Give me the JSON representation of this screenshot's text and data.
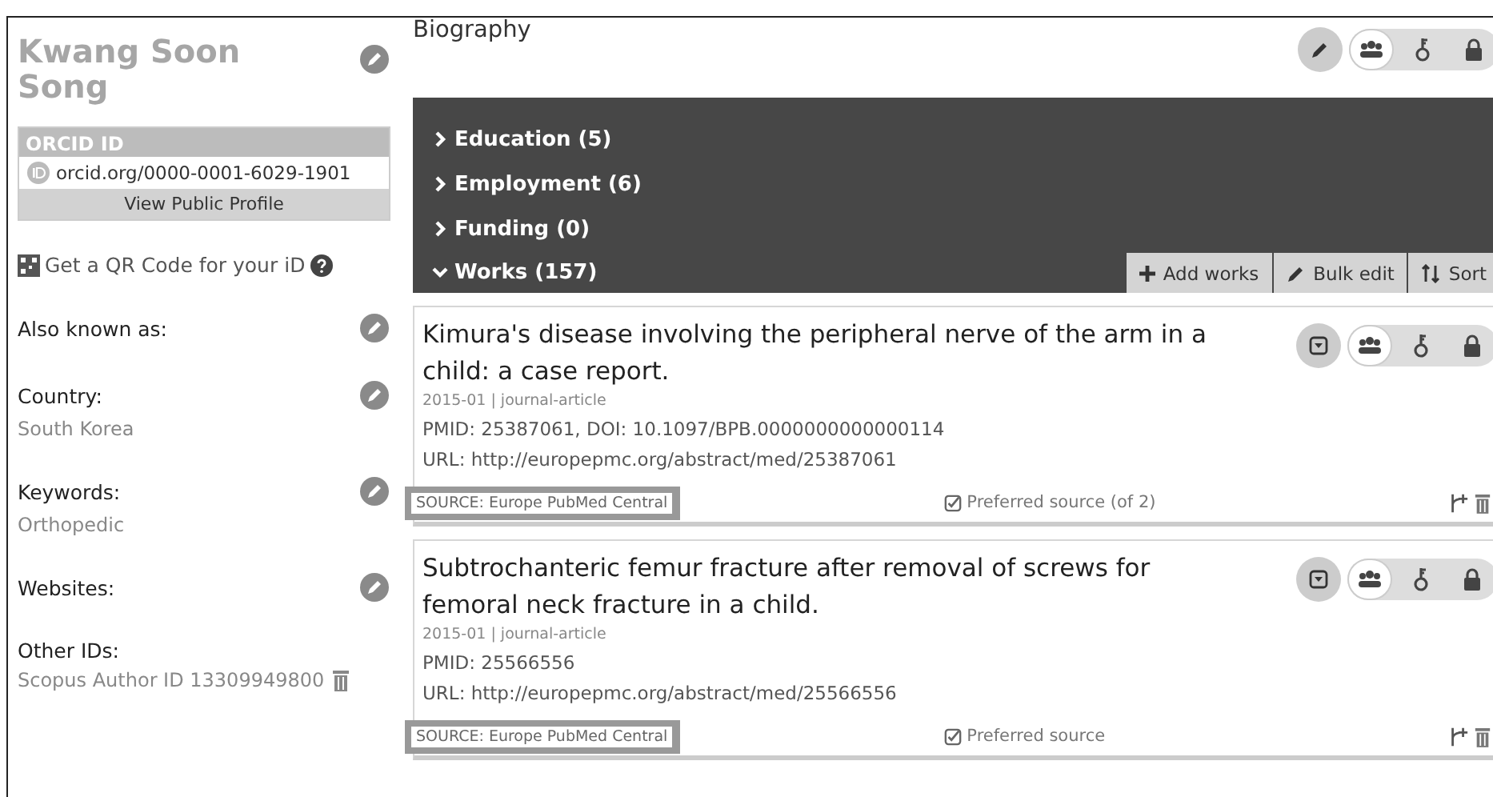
{
  "sidebar": {
    "name": "Kwang Soon Song",
    "orcid": {
      "heading": "ORCID ID",
      "id": "orcid.org/0000-0001-6029-1901",
      "view_button": "View Public Profile"
    },
    "qr_link": "Get a QR Code for your iD",
    "fields": [
      {
        "label": "Also known as:",
        "editable": true
      },
      {
        "label": "Country:",
        "value": "South Korea",
        "editable": true
      },
      {
        "label": "Keywords:",
        "value": "Orthopedic",
        "editable": true
      },
      {
        "label": "Websites:",
        "editable": true
      },
      {
        "label": "Other IDs:",
        "value": "Scopus Author ID 13309949800",
        "editable": false
      }
    ]
  },
  "biography": {
    "title": "Biography",
    "privacy": [
      {
        "kind": "everyone",
        "selected": true
      },
      {
        "kind": "trusted",
        "selected": false
      },
      {
        "kind": "private",
        "selected": false
      }
    ]
  },
  "sections": [
    {
      "label": "Education (5)",
      "expanded": false
    },
    {
      "label": "Employment (6)",
      "expanded": false
    },
    {
      "label": "Funding (0)",
      "expanded": false
    },
    {
      "label": "Works (157)",
      "expanded": true
    }
  ],
  "works_toolbar": [
    "Add works",
    "Bulk edit",
    "Sort"
  ],
  "works": [
    {
      "title": "Kimura's disease involving the peripheral nerve of the arm in a child: a case report.",
      "meta": "2015-01 | journal-article",
      "ids": "PMID: 25387061, DOI: 10.1097/BPB.0000000000000114",
      "url": "URL: http://europepmc.org/abstract/med/25387061",
      "source": "SOURCE: Europe PubMed Central",
      "preferred": "Preferred source (of 2)",
      "privacy": [
        {
          "kind": "everyone",
          "selected": true
        },
        {
          "kind": "trusted",
          "selected": false
        },
        {
          "kind": "private",
          "selected": false
        }
      ]
    },
    {
      "title": "Subtrochanteric femur fracture after removal of screws for femoral neck fracture in a child.",
      "meta": "2015-01 | journal-article",
      "ids": "PMID: 25566556",
      "url": "URL: http://europepmc.org/abstract/med/25566556",
      "source": "SOURCE: Europe PubMed Central",
      "preferred": "Preferred source",
      "privacy": [
        {
          "kind": "everyone",
          "selected": true
        },
        {
          "kind": "trusted",
          "selected": false
        },
        {
          "kind": "private",
          "selected": false
        }
      ]
    }
  ]
}
